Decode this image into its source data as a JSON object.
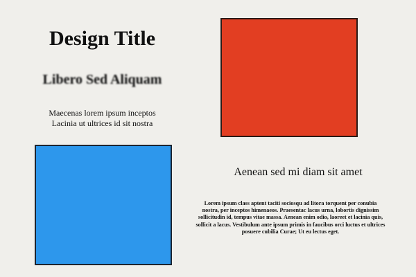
{
  "page": {
    "title": "Design Title",
    "subtitle": "Libero Sed Aliquam",
    "caption_lines": [
      "Maecenas lorem ipsum inceptos",
      "Lacinia ut ultrices id sit nostra"
    ],
    "right_heading": "Aenean sed mi diam sit amet",
    "body_text": "Lorem ipsum class aptent taciti sociosqu ad litora torquent per conubia nostra, per inceptos himenaeos. Praesentac lacus urna, lobortis dignissim sollicitudin id, tempus vitae massa. Aenean enim odio, laoreet et lacinia quis, sollicit a lacus. Vestibulum ante ipsum primis in faucibus orci luctus et ultrices posuere cubilia Curae; Ut eu lectus eget."
  },
  "colors": {
    "background": "#F0EFEB",
    "red_square": "#E23E22",
    "blue_square": "#2D97EC",
    "text": "#111111"
  }
}
